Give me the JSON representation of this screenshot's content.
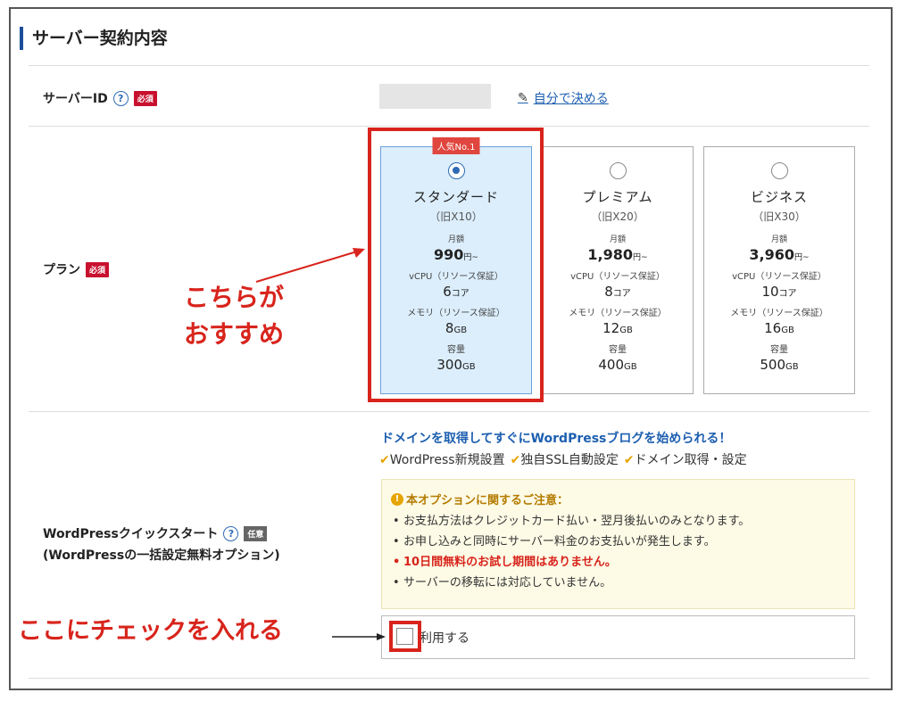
{
  "section_title": "サーバー契約内容",
  "server_id": {
    "label": "サーバーID",
    "help": "?",
    "badge": "必須",
    "self_link": "自分で決める"
  },
  "plan": {
    "label": "プラン",
    "badge": "必須",
    "cards": [
      {
        "badge": "人気No.1",
        "name": "スタンダード",
        "old": "（旧X10）",
        "price_label": "月額",
        "price": "990",
        "price_unit": "円~",
        "cpu_label": "vCPU（リソース保証）",
        "cpu": "6",
        "cpu_unit": "コア",
        "mem_label": "メモリ（リソース保証）",
        "mem": "8",
        "mem_unit": "GB",
        "disk_label": "容量",
        "disk": "300",
        "disk_unit": "GB",
        "selected": true
      },
      {
        "name": "プレミアム",
        "old": "（旧X20）",
        "price_label": "月額",
        "price": "1,980",
        "price_unit": "円~",
        "cpu_label": "vCPU（リソース保証）",
        "cpu": "8",
        "cpu_unit": "コア",
        "mem_label": "メモリ（リソース保証）",
        "mem": "12",
        "mem_unit": "GB",
        "disk_label": "容量",
        "disk": "400",
        "disk_unit": "GB",
        "selected": false
      },
      {
        "name": "ビジネス",
        "old": "（旧X30）",
        "price_label": "月額",
        "price": "3,960",
        "price_unit": "円~",
        "cpu_label": "vCPU（リソース保証）",
        "cpu": "10",
        "cpu_unit": "コア",
        "mem_label": "メモリ（リソース保証）",
        "mem": "16",
        "mem_unit": "GB",
        "disk_label": "容量",
        "disk": "500",
        "disk_unit": "GB",
        "selected": false
      }
    ]
  },
  "annotation_plan": "こちらが\nおすすめ",
  "wordpress": {
    "label_line1": "WordPressクイックスタート",
    "label_line2": "(WordPressの一括設定無料オプション)",
    "help": "?",
    "badge": "任意",
    "headline": "ドメインを取得してすぐにWordPressブログを始められる！",
    "features": [
      "WordPress新規設置",
      "独自SSL自動設定",
      "ドメイン取得・設定"
    ],
    "notice_title": "本オプションに関するご注意：",
    "notice_items": [
      {
        "text": "お支払方法はクレジットカード払い・翌月後払いのみとなります。",
        "warn": false
      },
      {
        "text": "お申し込みと同時にサーバー料金のお支払いが発生します。",
        "warn": false
      },
      {
        "text": "10日間無料のお試し期間はありません。",
        "warn": true
      },
      {
        "text": "サーバーの移転には対応していません。",
        "warn": false
      }
    ],
    "use_label": "利用する",
    "use_checked": false
  },
  "annotation_check": "ここにチェックを入れる"
}
